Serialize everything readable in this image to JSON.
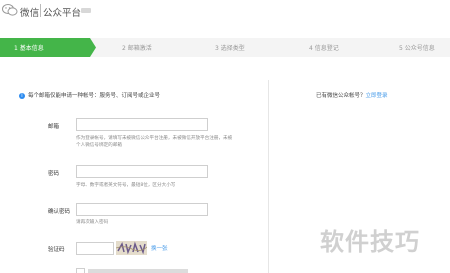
{
  "header": {
    "brand": "微信",
    "product": "公众平台"
  },
  "steps": [
    {
      "label": "1 基本信息",
      "active": true
    },
    {
      "label": "2 邮箱激活",
      "active": false
    },
    {
      "label": "3 选择类型",
      "active": false
    },
    {
      "label": "4 信息登记",
      "active": false
    },
    {
      "label": "5 公众号信息",
      "active": false
    }
  ],
  "form": {
    "notice": "每个邮箱仅能申请一种帐号：服务号、订阅号或企业号",
    "email": {
      "label": "邮箱",
      "value": "",
      "hint": "作为登录帐号，请填写未被微信公众平台注册，未被微信开放平台注册，未被个人微信号绑定的邮箱"
    },
    "password": {
      "label": "密码",
      "value": "",
      "hint": "字母、数字或者英文符号，最短8位，区分大小写"
    },
    "confirm": {
      "label": "确认密码",
      "value": "",
      "hint": "请再次输入密码"
    },
    "captcha": {
      "label": "验证码",
      "value": "",
      "change_label": "换一张"
    }
  },
  "side": {
    "question": "已有微信公众帐号？",
    "login_link": "立即登录"
  },
  "watermark": "软件技巧",
  "colors": {
    "accent": "#44b549",
    "link": "#459ae9"
  }
}
